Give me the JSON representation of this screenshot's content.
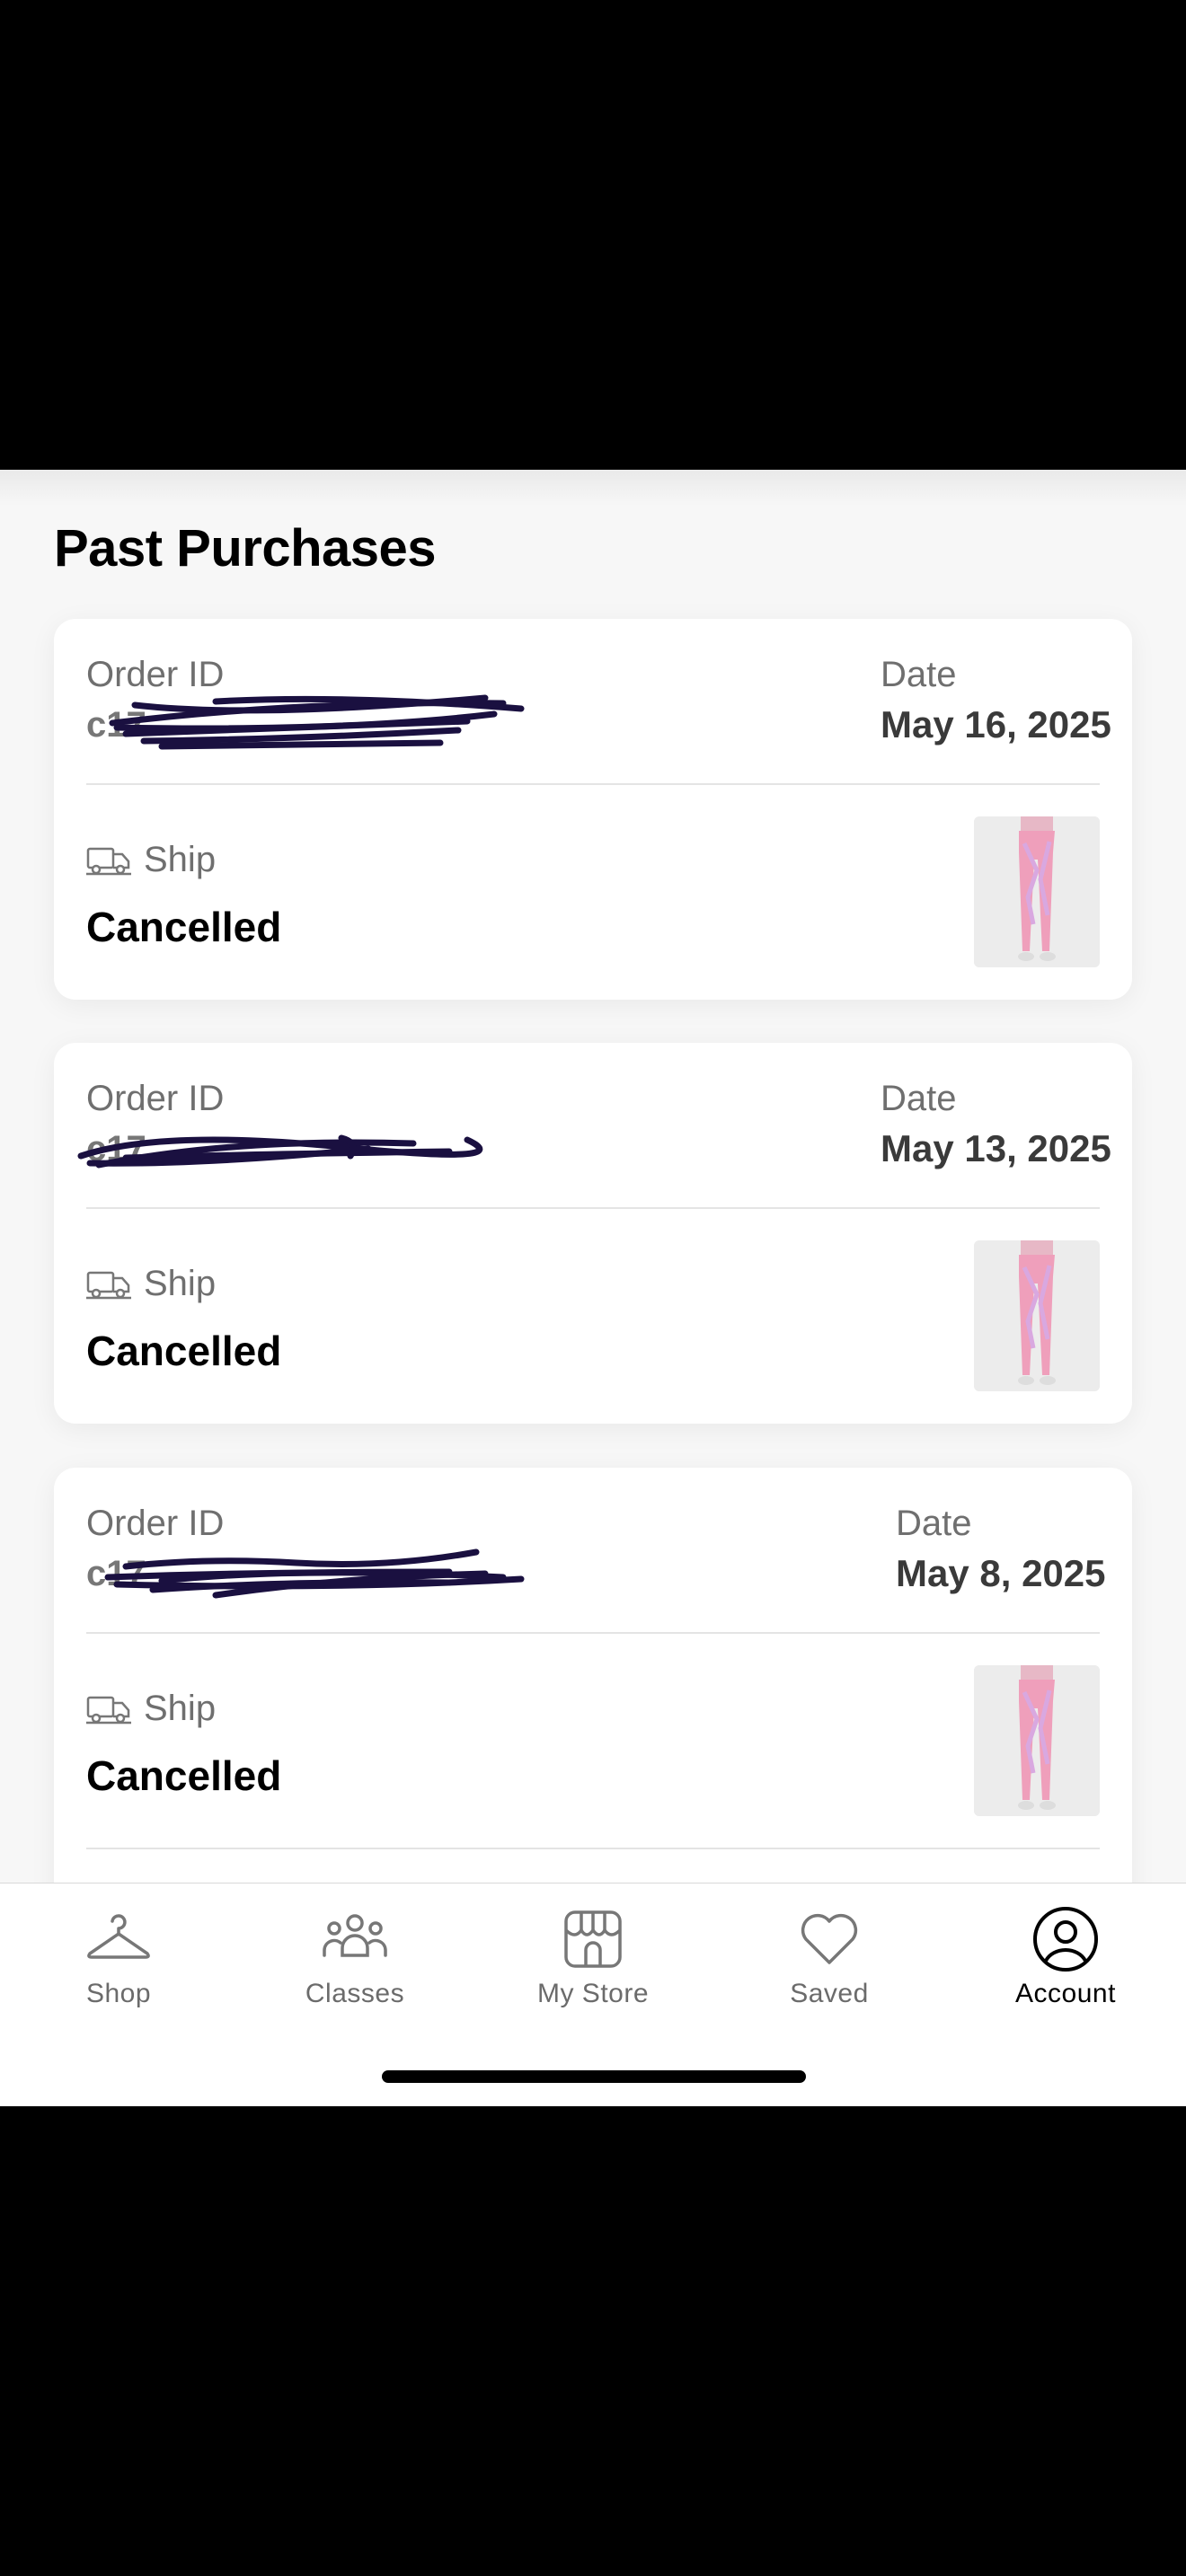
{
  "page": {
    "title": "Past Purchases"
  },
  "orders": [
    {
      "order_id_label": "Order ID",
      "order_id_visible": "c17",
      "date_label": "Date",
      "date": "May 16, 2025",
      "fulfillment": "Ship",
      "status": "Cancelled",
      "thumbnail": "pink-tie-dye-leggings"
    },
    {
      "order_id_label": "Order ID",
      "order_id_visible": "c17",
      "date_label": "Date",
      "date": "May 13, 2025",
      "fulfillment": "Ship",
      "status": "Cancelled",
      "thumbnail": "pink-tie-dye-leggings"
    },
    {
      "order_id_label": "Order ID",
      "order_id_visible": "c17",
      "date_label": "Date",
      "date": "May 8, 2025",
      "fulfillment": "Ship",
      "status": "Cancelled",
      "thumbnail": "pink-tie-dye-leggings"
    }
  ],
  "tabbar": {
    "items": [
      {
        "label": "Shop",
        "icon": "hanger-icon"
      },
      {
        "label": "Classes",
        "icon": "people-icon"
      },
      {
        "label": "My Store",
        "icon": "store-icon"
      },
      {
        "label": "Saved",
        "icon": "heart-icon"
      },
      {
        "label": "Account",
        "icon": "account-icon",
        "active": true
      }
    ]
  },
  "colors": {
    "background": "#f7f7f7",
    "card": "#ffffff",
    "redaction": "#1a1040",
    "label_gray": "#6f6f6f",
    "active_tab": "#000000"
  }
}
